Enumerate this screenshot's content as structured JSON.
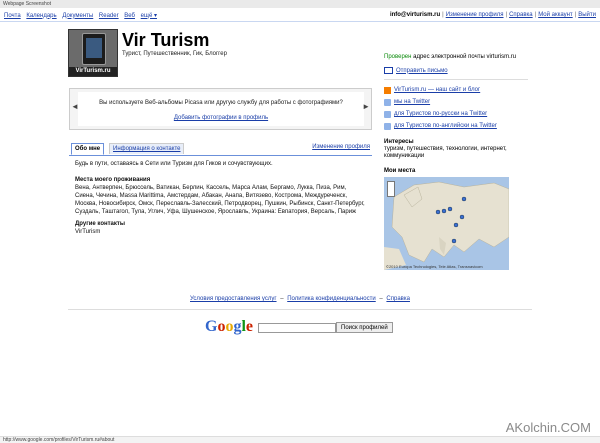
{
  "window": {
    "title": "Webpage Screenshot"
  },
  "topnav": {
    "left": [
      "Почта",
      "Календарь",
      "Документы",
      "Reader",
      "Веб",
      "ещё ▾"
    ],
    "email": "info@virturism.ru",
    "right": [
      "Изменение профиля",
      "Справка",
      "Мой аккаунт",
      "Выйти"
    ]
  },
  "profile": {
    "avatar_caption": "VirTurism.ru",
    "name": "Vir Turism",
    "tagline": "Турист, Путешественник, Гик, Блоггер",
    "verified_word": "Проверен",
    "verified_rest": " адрес электронной почты virturism.ru",
    "send_mail": "Отправить письмо"
  },
  "links": [
    {
      "icon": "blog-icon",
      "text": "VirTurism.ru — наш сайт и блог"
    },
    {
      "icon": "link-icon",
      "text": "мы на Twitter"
    },
    {
      "icon": "link-icon",
      "text": "для Туристов по-русски на Twitter"
    },
    {
      "icon": "link-icon",
      "text": "для Туристов по-английски на Twitter"
    }
  ],
  "picasa": {
    "message": "Вы используете Веб-альбомы Picasa или другую службу для работы с фотографиями?",
    "add": "Добавить фотографии в профиль",
    "prev": "◄",
    "next": "►"
  },
  "tabs": {
    "about": "Обо мне",
    "contact": "Информация о контакте",
    "edit": "Изменение профиля"
  },
  "about": {
    "intro": "Будь в пути, оставаясь в Сети или Туризм для Гиков и сочувствующих.",
    "places_heading": "Места моего проживания",
    "places": "Вена, Антверпен, Брюссель, Ватикан, Берлин, Кассель, Марса Алам, Бергамо, Лукка, Пиза, Рим, Сиена, Чечина, Massa Marittima, Амстердам, Абакан, Анапа, Витязево, Кострома, Междуреченск, Москва, Новосибирск, Омск, Переславль-Залесский, Петродворец, Пушкин, Рыбинск, Санкт-Петербург, Суздаль, Таштагол, Тула, Углич, Уфа, Шушенское, Ярославль, Украина: Евпатория, Версаль, Париж",
    "other_heading": "Другие контакты",
    "other": "VirTurism"
  },
  "interests": {
    "heading": "Интересы",
    "text": "туризм, путешествия, технологии, интернет, коммуникации"
  },
  "map": {
    "heading": "Мои места",
    "copyright": "©2010 Europa Technologies, Tele Atlas, Transnavicom"
  },
  "footer": {
    "terms": "Условия предоставления услуг",
    "privacy": "Политика конфиденциальности",
    "help": "Справка",
    "sep": "–"
  },
  "search": {
    "logo": "Google",
    "input_value": "",
    "button": "Поиск профилей"
  },
  "status": {
    "url": "http://www.google.com/profiles/VirTurism.ru#about"
  },
  "watermark": "AKolchin.COM",
  "colors": {
    "link": "#1a3ea8",
    "verified": "#0a8a0a",
    "blog": "#f57d00"
  }
}
